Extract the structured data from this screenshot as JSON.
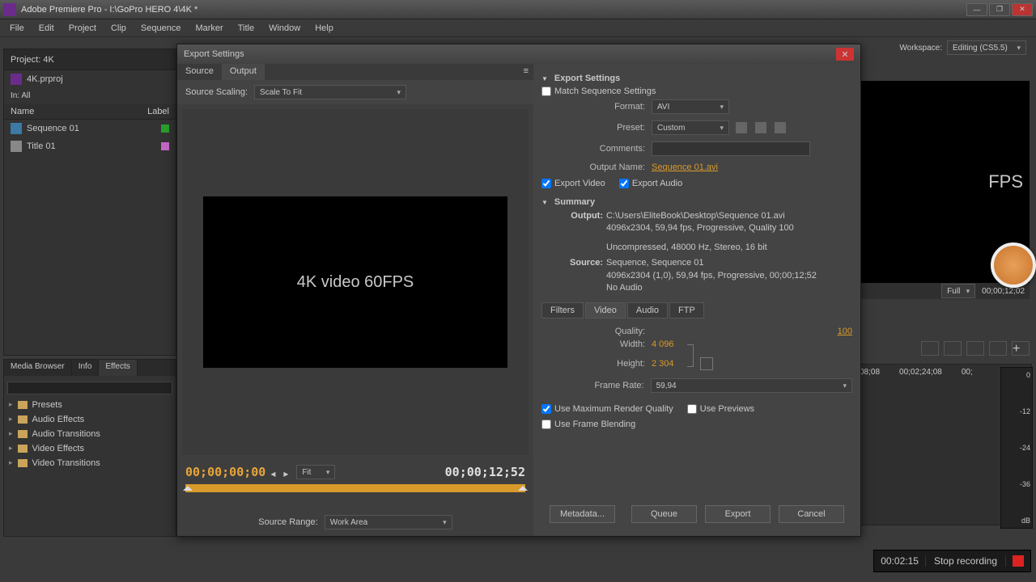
{
  "titlebar": {
    "title": "Adobe Premiere Pro - I:\\GoPro HERO 4\\4K *"
  },
  "menu": [
    "File",
    "Edit",
    "Project",
    "Clip",
    "Sequence",
    "Marker",
    "Title",
    "Window",
    "Help"
  ],
  "workspace": {
    "label": "Workspace:",
    "value": "Editing (CS5.5)"
  },
  "project": {
    "tab": "Project: 4K",
    "file": "4K.prproj",
    "in_label": "In:",
    "in_value": "All",
    "col_name": "Name",
    "col_label": "Label",
    "items": [
      {
        "name": "Sequence 01",
        "swatch": "green",
        "icon": "icon-seq"
      },
      {
        "name": "Title 01",
        "swatch": "pink",
        "icon": "icon-title"
      }
    ]
  },
  "lower_tabs": [
    "Media Browser",
    "Info",
    "Effects"
  ],
  "lower_active": "Effects",
  "folders": [
    "Presets",
    "Audio Effects",
    "Audio Transitions",
    "Video Effects",
    "Video Transitions"
  ],
  "preview_right": {
    "text": "FPS",
    "fit": "Full",
    "time": "00;00;12;02"
  },
  "timeline": {
    "times": [
      "08;08",
      "00;02;24;08",
      "00;"
    ],
    "levels": [
      "0",
      "-12",
      "-24",
      "-36",
      "dB"
    ]
  },
  "dialog": {
    "title": "Export Settings",
    "tabs": [
      "Source",
      "Output"
    ],
    "active_tab": "Output",
    "source_scaling_label": "Source Scaling:",
    "source_scaling_value": "Scale To Fit",
    "preview_text": "4K video 60FPS",
    "time_left": "00;00;00;00",
    "time_right": "00;00;12;52",
    "fit": "Fit",
    "source_range_label": "Source Range:",
    "source_range_value": "Work Area",
    "settings": {
      "heading": "Export Settings",
      "match": "Match Sequence Settings",
      "format_label": "Format:",
      "format_value": "AVI",
      "preset_label": "Preset:",
      "preset_value": "Custom",
      "comments_label": "Comments:",
      "output_name_label": "Output Name:",
      "output_name_value": "Sequence 01.avi",
      "export_video": "Export Video",
      "export_audio": "Export Audio",
      "summary": "Summary",
      "output_label": "Output:",
      "output_path": "C:\\Users\\EliteBook\\Desktop\\Sequence 01.avi",
      "output_spec": "4096x2304, 59,94 fps, Progressive, Quality 100",
      "output_audio": "Uncompressed, 48000 Hz, Stereo, 16 bit",
      "source_label": "Source:",
      "source_seq": "Sequence, Sequence 01",
      "source_spec": "4096x2304 (1,0), 59,94 fps, Progressive, 00;00;12;52",
      "source_audio": "No Audio",
      "subtabs": [
        "Filters",
        "Video",
        "Audio",
        "FTP"
      ],
      "subtab_active": "Video",
      "quality_label": "Quality:",
      "quality_value": "100",
      "width_label": "Width:",
      "width_value": "4 096",
      "height_label": "Height:",
      "height_value": "2 304",
      "framerate_label": "Frame Rate:",
      "framerate_value": "59,94",
      "use_max": "Use Maximum Render Quality",
      "use_previews": "Use Previews",
      "use_frameblend": "Use Frame Blending",
      "buttons": [
        "Metadata...",
        "Queue",
        "Export",
        "Cancel"
      ]
    }
  },
  "recorder": {
    "time": "00:02:15",
    "label": "Stop recording"
  }
}
